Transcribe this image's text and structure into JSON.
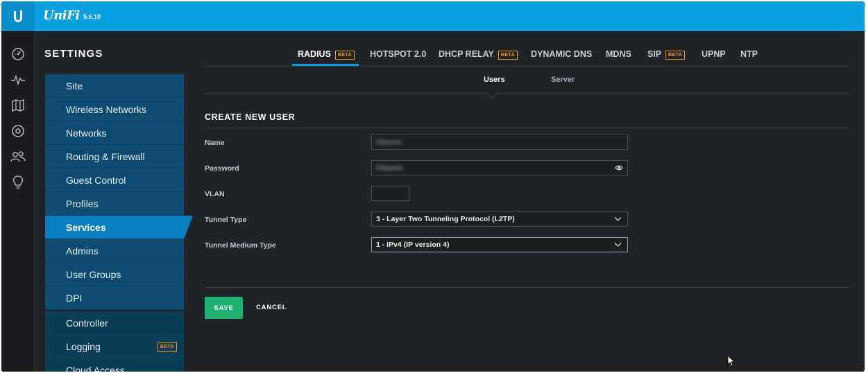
{
  "app": {
    "brand": "UniFi",
    "version": "5.6.10"
  },
  "rail": {
    "icons": [
      "dashboard-icon",
      "statistics-icon",
      "map-icon",
      "devices-icon",
      "clients-icon",
      "insights-icon"
    ]
  },
  "settings": {
    "title": "SETTINGS",
    "menu": [
      {
        "label": "Site"
      },
      {
        "label": "Wireless Networks"
      },
      {
        "label": "Networks"
      },
      {
        "label": "Routing & Firewall"
      },
      {
        "label": "Guest Control"
      },
      {
        "label": "Profiles"
      },
      {
        "label": "Services",
        "active": true
      },
      {
        "label": "Admins"
      },
      {
        "label": "User Groups"
      },
      {
        "label": "DPI"
      }
    ],
    "menu2": [
      {
        "label": "Controller"
      },
      {
        "label": "Logging",
        "badge": "BETA"
      },
      {
        "label": "Cloud Access"
      }
    ]
  },
  "tabs": [
    {
      "label": "RADIUS",
      "badge": "BETA",
      "active": true
    },
    {
      "label": "HOTSPOT 2.0"
    },
    {
      "label": "DHCP RELAY",
      "badge": "BETA"
    },
    {
      "label": "DYNAMIC DNS"
    },
    {
      "label": "MDNS"
    },
    {
      "label": "SIP",
      "badge": "BETA"
    },
    {
      "label": "UPNP"
    },
    {
      "label": "NTP"
    }
  ],
  "subtabs": [
    {
      "label": "Users",
      "active": true
    },
    {
      "label": "Server"
    }
  ],
  "form": {
    "title": "CREATE NEW USER",
    "name_label": "Name",
    "name_value": "l2tpuser",
    "password_label": "Password",
    "password_value": "l2tppass",
    "vlan_label": "VLAN",
    "vlan_value": "",
    "tunnel_type_label": "Tunnel Type",
    "tunnel_type_value": "3 - Layer Two Tunneling Protocol (L2TP)",
    "tunnel_medium_label": "Tunnel Medium Type",
    "tunnel_medium_value": "1 - IPv4 (IP version 4)"
  },
  "actions": {
    "save": "SAVE",
    "cancel": "CANCEL"
  },
  "colors": {
    "topbar": "#0a9fdf",
    "menu": "#0d4b70",
    "menu_active": "#0a7cc0",
    "save": "#1fb36f",
    "beta": "#f39a1d"
  }
}
